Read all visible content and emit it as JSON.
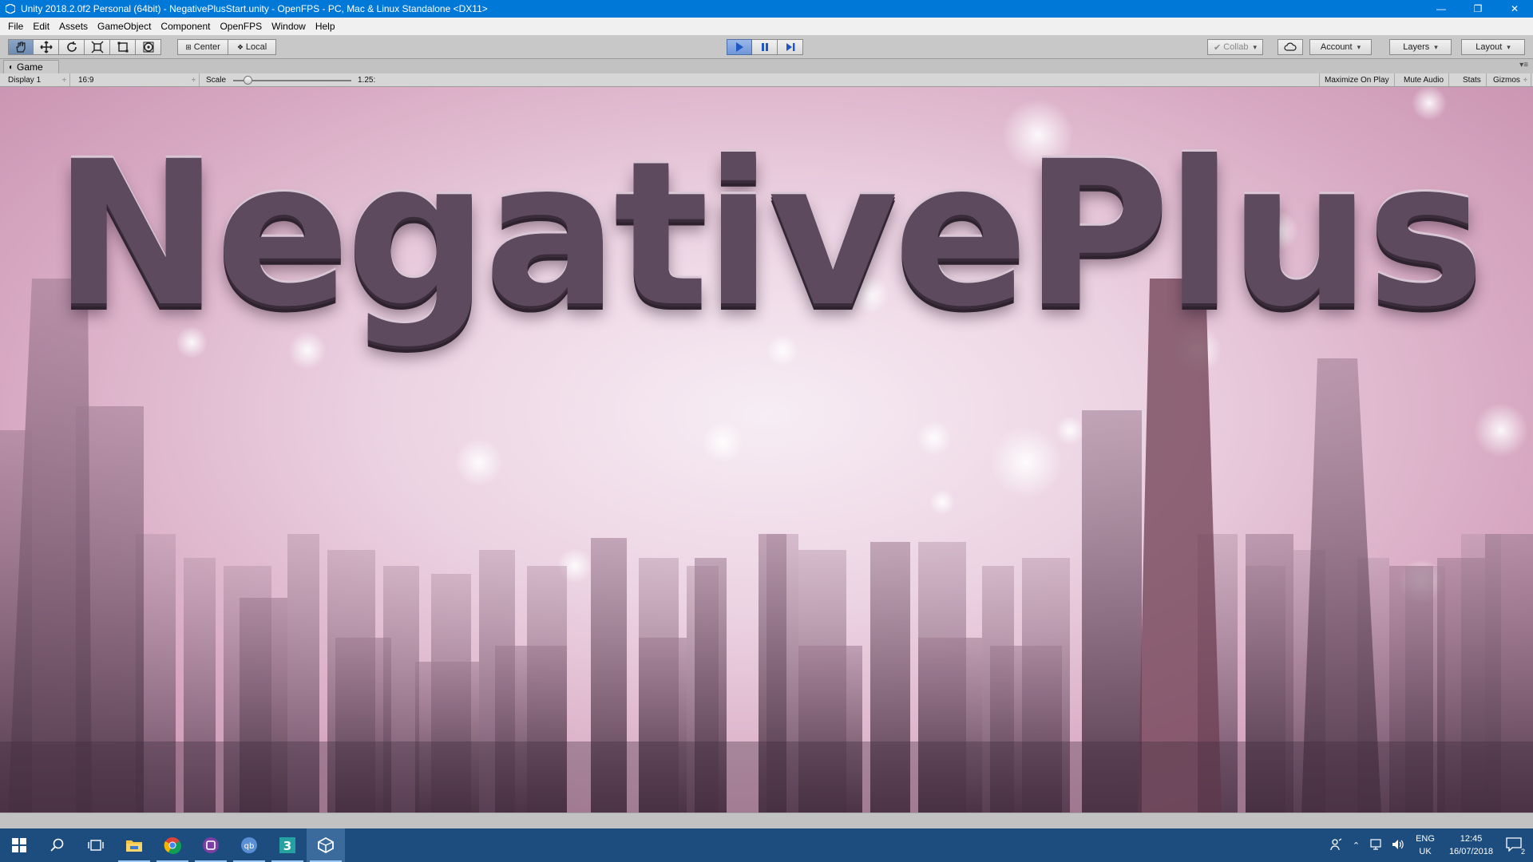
{
  "window": {
    "title": "Unity 2018.2.0f2 Personal (64bit) - NegativePlusStart.unity - OpenFPS - PC, Mac & Linux Standalone <DX11>"
  },
  "menu": [
    "File",
    "Edit",
    "Assets",
    "GameObject",
    "Component",
    "OpenFPS",
    "Window",
    "Help"
  ],
  "toolbar": {
    "tools": [
      "hand-tool-icon",
      "move-tool-icon",
      "rotate-tool-icon",
      "scale-tool-icon",
      "rect-tool-icon",
      "transform-tool-icon"
    ],
    "pivot_label": "Center",
    "space_label": "Local",
    "collab_label": "Collab",
    "account_label": "Account",
    "layers_label": "Layers",
    "layout_label": "Layout"
  },
  "game_panel": {
    "tab_label": "Game",
    "display_label": "Display 1",
    "aspect_label": "16:9",
    "scale_label": "Scale",
    "scale_value": "1.25:",
    "scale_fraction": 0.12,
    "maximize_label": "Maximize On Play",
    "mute_label": "Mute Audio",
    "stats_label": "Stats",
    "gizmos_label": "Gizmos"
  },
  "game_view": {
    "logo_text": "NegativePlus"
  },
  "taskbar": {
    "apps": [
      "start-icon",
      "search-icon",
      "task-view-icon",
      "file-explorer-icon",
      "chrome-icon",
      "app-purple-icon",
      "qbittorrent-icon",
      "app-3-icon",
      "unity-icon"
    ],
    "lang_top": "ENG",
    "lang_bottom": "UK",
    "time": "12:45",
    "date": "16/07/2018",
    "notification_count": "2"
  }
}
